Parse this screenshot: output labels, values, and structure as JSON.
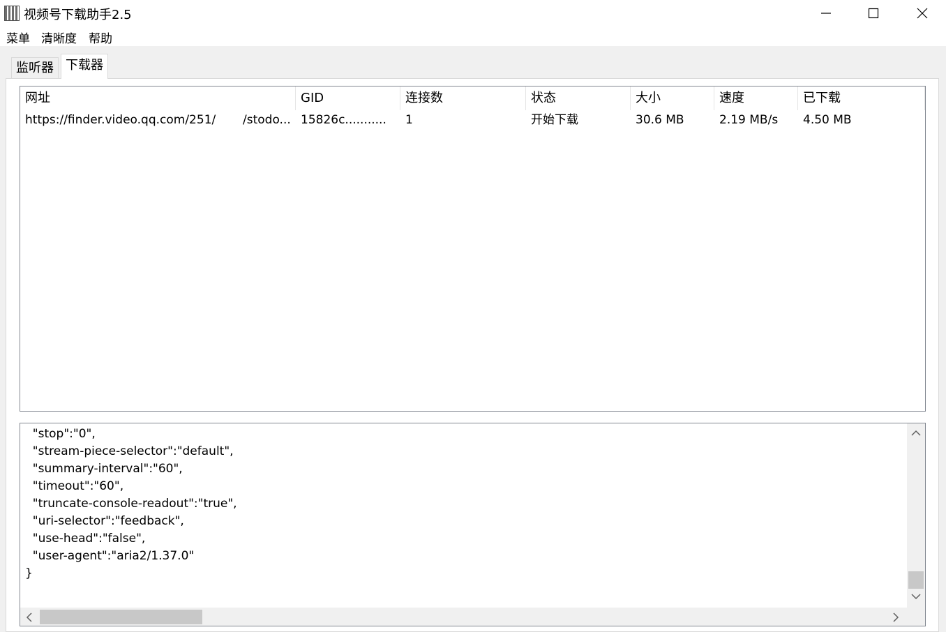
{
  "window": {
    "title": "视频号下载助手2.5"
  },
  "menu": [
    "菜单",
    "清晰度",
    "帮助"
  ],
  "tabs": [
    {
      "label": "监听器",
      "active": false
    },
    {
      "label": "下载器",
      "active": true
    }
  ],
  "table": {
    "columns": [
      "网址",
      "GID",
      "连接数",
      "状态",
      "大小",
      "速度",
      "已下载"
    ],
    "rows": [
      {
        "url": "https://finder.video.qq.com/251/",
        "url_tail": "/stodo...",
        "gid": "15826c...........",
        "connections": "1",
        "status": "开始下载",
        "size": "30.6 MB",
        "speed": "2.19 MB/s",
        "downloaded": "4.50 MB"
      }
    ]
  },
  "log_lines": [
    "  \"stop\":\"0\",",
    "  \"stream-piece-selector\":\"default\",",
    "  \"summary-interval\":\"60\",",
    "  \"timeout\":\"60\",",
    "  \"truncate-console-readout\":\"true\",",
    "  \"uri-selector\":\"feedback\",",
    "  \"use-head\":\"false\",",
    "  \"user-agent\":\"aria2/1.37.0\"",
    "}"
  ],
  "icons": {
    "app": "qr-app-icon",
    "minimize": "minimize-icon",
    "maximize": "maximize-icon",
    "close": "close-icon",
    "scroll_up": "chevron-up-icon",
    "scroll_down": "chevron-down-icon",
    "scroll_left": "chevron-left-icon",
    "scroll_right": "chevron-right-icon"
  },
  "colors": {
    "client_bg": "#f0f0f0",
    "border": "#828790",
    "scroll_thumb": "#c8c8c8"
  }
}
